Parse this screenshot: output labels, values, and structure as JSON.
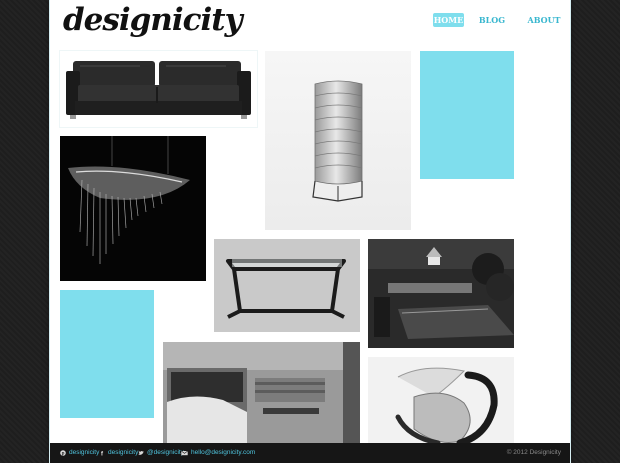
{
  "site": {
    "logo_text": "designicity"
  },
  "nav": {
    "items": [
      "HOME",
      "BLOG",
      "ABOUT"
    ],
    "active": "HOME"
  },
  "gallery": {
    "items": [
      {
        "kind": "photo",
        "subject": "sofa-photo"
      },
      {
        "kind": "photo",
        "subject": "tall-metal-cabinet-photo"
      },
      {
        "kind": "color-block",
        "color": "#7fdeed"
      },
      {
        "kind": "photo",
        "subject": "chandelier-photo"
      },
      {
        "kind": "photo",
        "subject": "glass-table-photo"
      },
      {
        "kind": "photo",
        "subject": "restaurant-interior-photo"
      },
      {
        "kind": "color-block",
        "color": "#7fdeed"
      },
      {
        "kind": "photo",
        "subject": "bedroom-photo"
      },
      {
        "kind": "photo",
        "subject": "curved-chair-photo"
      }
    ]
  },
  "footer": {
    "links": [
      {
        "icon": "pinterest-icon",
        "label": "designicity"
      },
      {
        "icon": "facebook-icon",
        "label": "designicity"
      },
      {
        "icon": "twitter-icon",
        "label": "@designicity"
      },
      {
        "icon": "mail-icon",
        "label": "hello@designicity.com"
      }
    ],
    "copyright": "© 2012 Designicity"
  },
  "colors": {
    "accent": "#7fdeed",
    "link": "#4fc3dc",
    "background": "#1e1e1e",
    "footer_bg": "#161616"
  }
}
